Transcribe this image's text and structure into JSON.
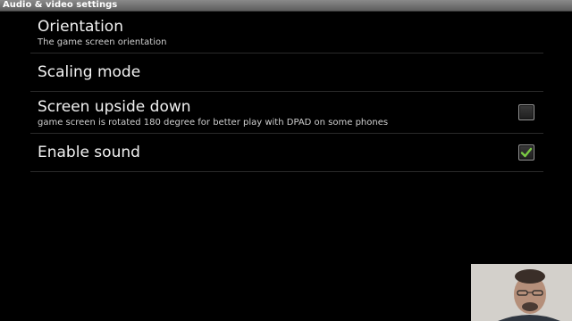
{
  "window": {
    "title": "Audio & video settings"
  },
  "settings": [
    {
      "title": "Orientation",
      "summary": "The game screen orientation",
      "has_checkbox": false
    },
    {
      "title": "Scaling mode",
      "summary": "",
      "has_checkbox": false
    },
    {
      "title": "Screen upside down",
      "summary": "game screen is rotated 180 degree for better play with DPAD on some phones",
      "has_checkbox": true,
      "checked": false
    },
    {
      "title": "Enable sound",
      "summary": "",
      "has_checkbox": true,
      "checked": true
    }
  ],
  "colors": {
    "check_mark": "#7ac943"
  }
}
